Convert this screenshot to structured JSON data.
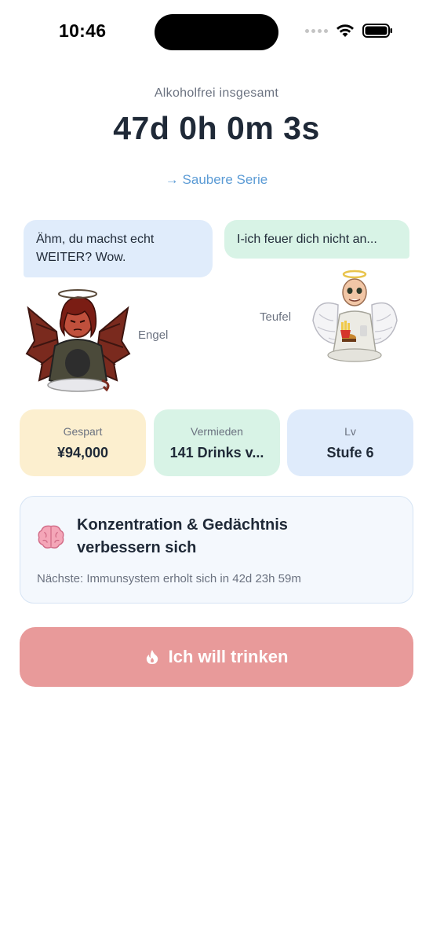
{
  "status_bar": {
    "time": "10:46"
  },
  "header": {
    "label": "Alkoholfrei insgesamt",
    "total_time": "47d 0h 0m 3s",
    "link": "→ Saubere Serie"
  },
  "bubbles": {
    "left": "Ähm, du machst echt WEITER? Wow.",
    "right": "I-ich feuer dich nicht an..."
  },
  "characters": {
    "devil_label": "Engel",
    "angel_label": "Teufel"
  },
  "stats": [
    {
      "label": "Gespart",
      "value": "¥94,000",
      "color": "#fcefcf"
    },
    {
      "label": "Vermieden",
      "value": "141 Drinks v...",
      "color": "#d8f3e6"
    },
    {
      "label": "Lv",
      "value": "Stufe 6",
      "color": "#dfebfb"
    }
  ],
  "milestone": {
    "icon": "brain-icon",
    "title": "Konzentration & Gedächtnis verbessern sich",
    "next": "Nächste: Immunsystem erholt sich in 42d 23h 59m"
  },
  "drink_button": {
    "icon": "flame-icon",
    "label": "Ich will trinken",
    "color": "#e89a9a"
  }
}
